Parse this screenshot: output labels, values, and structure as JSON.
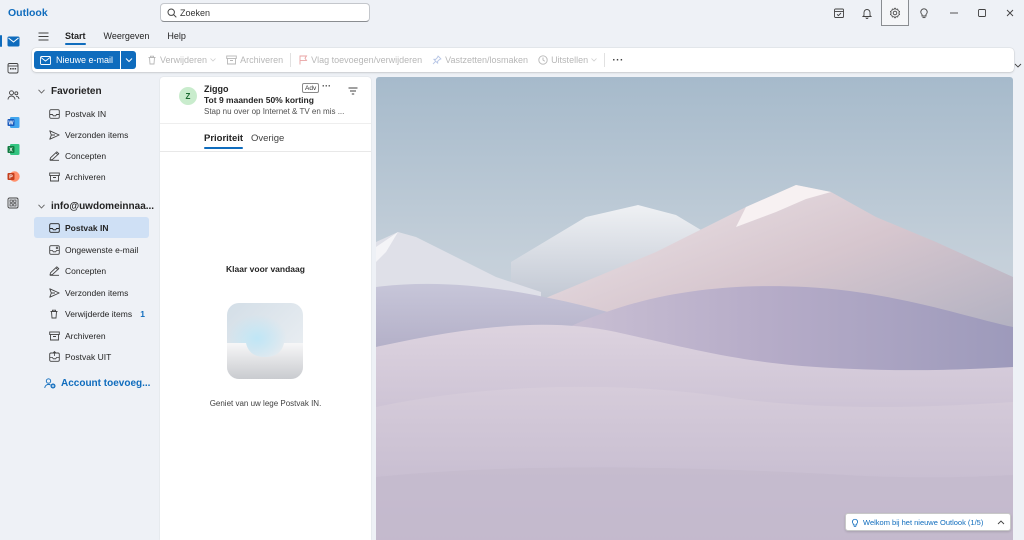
{
  "app": {
    "title": "Outlook"
  },
  "search": {
    "placeholder": "Zoeken"
  },
  "ribbon": {
    "tabs": [
      {
        "label": "Start"
      },
      {
        "label": "Weergeven"
      },
      {
        "label": "Help"
      }
    ],
    "active_tab": "Start"
  },
  "toolbar": {
    "new_mail": "Nieuwe e-mail",
    "delete": "Verwijderen",
    "archive": "Archiveren",
    "flag": "Vlag toevoegen/verwijderen",
    "pin": "Vastzetten/losmaken",
    "snooze": "Uitstellen",
    "more": "···"
  },
  "folders": {
    "favorites": {
      "header": "Favorieten",
      "items": [
        {
          "label": "Postvak IN",
          "icon": "inbox-icon"
        },
        {
          "label": "Verzonden items",
          "icon": "send-icon"
        },
        {
          "label": "Concepten",
          "icon": "pencil-icon"
        },
        {
          "label": "Archiveren",
          "icon": "archive-icon"
        }
      ]
    },
    "account": {
      "header": "info@uwdomeinnaa...",
      "items": [
        {
          "label": "Postvak IN",
          "icon": "inbox-icon",
          "selected": true
        },
        {
          "label": "Ongewenste e-mail",
          "icon": "junk-icon"
        },
        {
          "label": "Concepten",
          "icon": "pencil-icon"
        },
        {
          "label": "Verzonden items",
          "icon": "send-icon"
        },
        {
          "label": "Verwijderde items",
          "icon": "trash-icon",
          "count": "1"
        },
        {
          "label": "Archiveren",
          "icon": "archive-icon"
        },
        {
          "label": "Postvak UIT",
          "icon": "outbox-icon"
        }
      ]
    },
    "add_account": "Account toevoeg..."
  },
  "ad": {
    "avatar": "Z",
    "sender": "Ziggo",
    "badge": "Adv",
    "more": "···",
    "subject": "Tot 9 maanden 50% korting",
    "preview": "Stap nu over op Internet & TV en mis ..."
  },
  "list_tabs": [
    {
      "label": "Prioriteit",
      "active": true
    },
    {
      "label": "Overige",
      "active": false
    }
  ],
  "empty_state": {
    "title": "Klaar voor vandaag",
    "subtitle": "Geniet van uw lege Postvak IN."
  },
  "welcome": {
    "text": "Welkom bij het nieuwe Outlook  (1/5)"
  },
  "colors": {
    "accent": "#0f6cbd",
    "selected": "#cfe0f5",
    "word": "#185abd",
    "excel": "#107c41",
    "powerpoint": "#c43e1c"
  }
}
